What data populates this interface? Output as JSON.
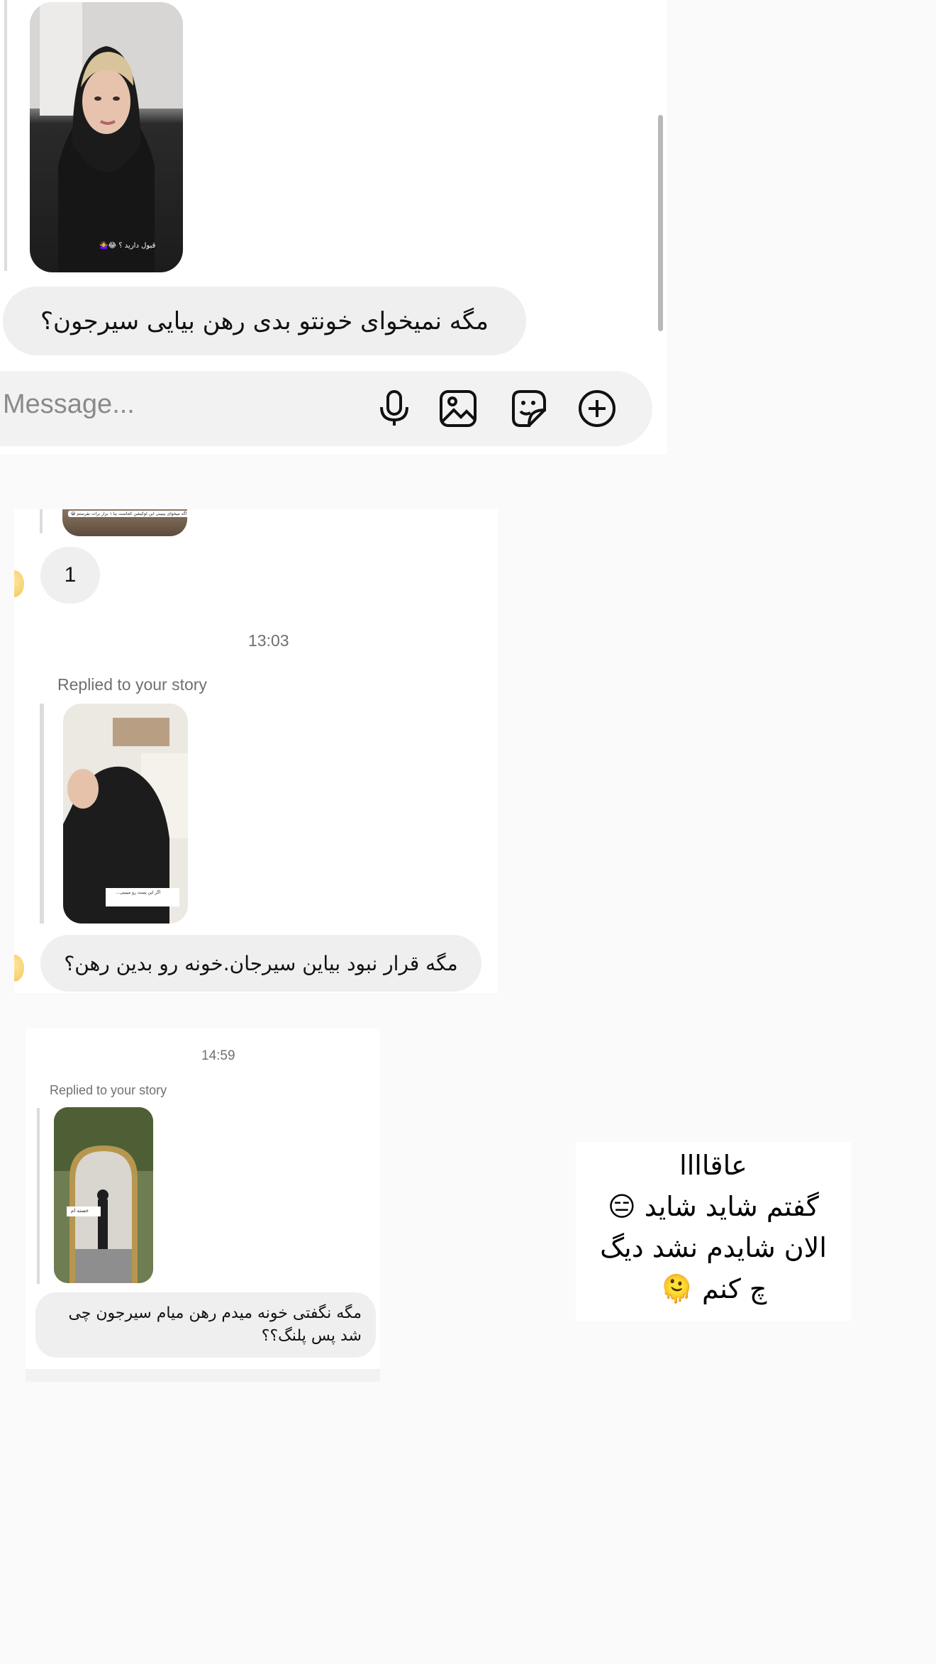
{
  "top_chat": {
    "story_caption": "قبول دارید ؟ 😂🤷‍♀️",
    "message": "مگه نمیخوای خونتو بدی رهن بیایی سیرجون؟",
    "composer": {
      "placeholder": "Message...",
      "icons": [
        "microphone-icon",
        "image-icon",
        "sticker-icon",
        "plus-circle-icon"
      ]
    }
  },
  "middle_chat": {
    "top_story_caption": "اگه میخوای بیبینی این لوکیشن کجاست بیا ۱ بزار برات بفرستم 😁",
    "reply_number": "1",
    "timestamp": "13:03",
    "replied_label": "Replied to your story",
    "story_caption": "اگر این پست رو میبینی...",
    "message": "مگه قرار نبود بیاین سیرجان.خونه رو بدین رهن؟"
  },
  "bottom_chat": {
    "timestamp": "14:59",
    "replied_label": "Replied to your story",
    "story_caption": "خسته ام",
    "message": "مگه نگفتی خونه میدم رهن میام سیرجون چی شد پس پلنگ؟؟"
  },
  "caption_text": {
    "line1": "عاقاااا",
    "line2": "گفتم شاید شاید 😑",
    "line3": "الان شایدم نشد دیگ",
    "line4": "چ کنم 🫠"
  },
  "colors": {
    "bubble": "#efeff0",
    "page_bg": "#fafafa",
    "panel_bg": "#ffffff",
    "muted_text": "#707070"
  }
}
